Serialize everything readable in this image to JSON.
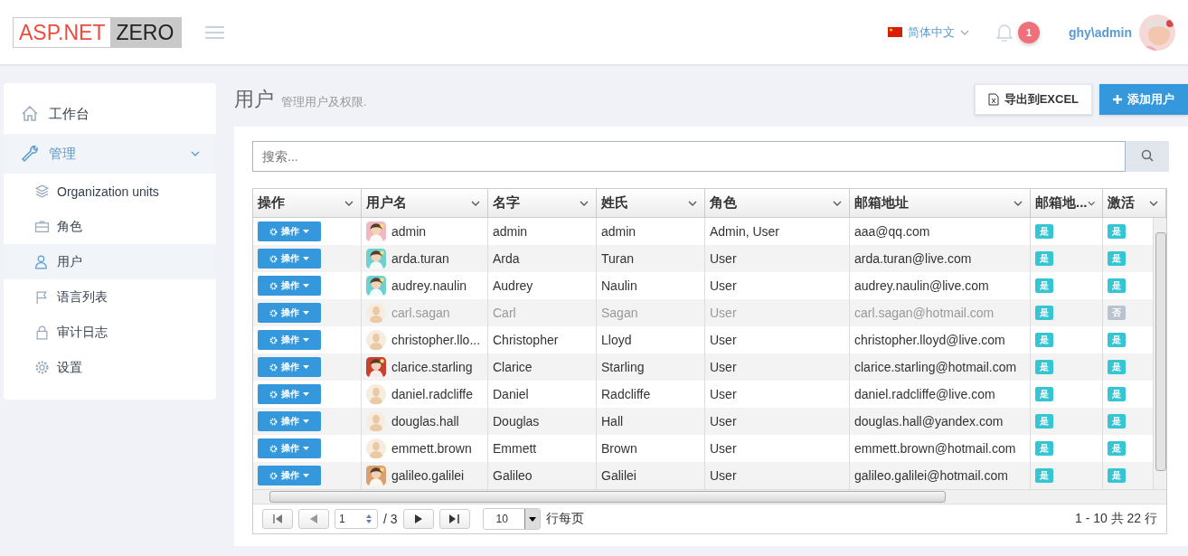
{
  "header": {
    "logo": {
      "left": "ASP.NET",
      "right": "ZERO"
    },
    "language": "简体中文",
    "notifications": "1",
    "user": "ghy\\admin"
  },
  "sidebar": {
    "items": [
      {
        "label": "工作台",
        "selected": false
      },
      {
        "label": "管理",
        "selected": false,
        "expanded": true,
        "children": [
          {
            "label": "Organization units",
            "selected": false
          },
          {
            "label": "角色",
            "selected": false
          },
          {
            "label": "用户",
            "selected": true
          },
          {
            "label": "语言列表",
            "selected": false
          },
          {
            "label": "审计日志",
            "selected": false
          },
          {
            "label": "设置",
            "selected": false
          }
        ]
      }
    ]
  },
  "page": {
    "title": "用户",
    "subtitle": "管理用户及权限.",
    "buttons": [
      {
        "label": "导出到EXCEL",
        "kind": "export"
      },
      {
        "label": "添加用户",
        "kind": "add"
      }
    ]
  },
  "search": {
    "placeholder": "搜索..."
  },
  "table": {
    "columns": [
      "操作",
      "用户名",
      "名字",
      "姓氏",
      "角色",
      "邮箱地址",
      "邮箱地...",
      "激活"
    ],
    "rows": [
      {
        "action": "操作",
        "username": "admin",
        "name": "admin",
        "surname": "admin",
        "roles": "Admin, User",
        "email": "aaa@qq.com",
        "email_confirmed": "是",
        "active_label": "是",
        "active": true
      },
      {
        "action": "操作",
        "username": "arda.turan",
        "name": "Arda",
        "surname": "Turan",
        "roles": "User",
        "email": "arda.turan@live.com",
        "email_confirmed": "是",
        "active_label": "是",
        "active": true
      },
      {
        "action": "操作",
        "username": "audrey.naulin",
        "name": "Audrey",
        "surname": "Naulin",
        "roles": "User",
        "email": "audrey.naulin@live.com",
        "email_confirmed": "是",
        "active_label": "是",
        "active": true
      },
      {
        "action": "操作",
        "avatar": {
          "kind": "default"
        },
        "username": "carl.sagan",
        "name": "Carl",
        "surname": "Sagan",
        "roles": "User",
        "email": "carl.sagan@hotmail.com",
        "email_confirmed": "是",
        "active_label": "否",
        "active": false
      },
      {
        "action": "操作",
        "avatar": {
          "kind": "default"
        },
        "username": "christopher.llo...",
        "name": "Christopher",
        "surname": "Lloyd",
        "roles": "User",
        "email": "christopher.lloyd@live.com",
        "email_confirmed": "是",
        "active_label": "是",
        "active": true
      },
      {
        "action": "操作",
        "username": "clarice.starling",
        "name": "Clarice",
        "surname": "Starling",
        "roles": "User",
        "email": "clarice.starling@hotmail.com",
        "email_confirmed": "是",
        "active_label": "是",
        "active": true
      },
      {
        "action": "操作",
        "avatar": {
          "kind": "default"
        },
        "username": "daniel.radcliffe",
        "name": "Daniel",
        "surname": "Radcliffe",
        "roles": "User",
        "email": "daniel.radcliffe@live.com",
        "email_confirmed": "是",
        "active_label": "是",
        "active": true
      },
      {
        "action": "操作",
        "avatar": {
          "kind": "default"
        },
        "username": "douglas.hall",
        "name": "Douglas",
        "surname": "Hall",
        "roles": "User",
        "email": "douglas.hall@yandex.com",
        "email_confirmed": "是",
        "active_label": "是",
        "active": true
      },
      {
        "action": "操作",
        "avatar": {
          "kind": "default"
        },
        "username": "emmett.brown",
        "name": "Emmett",
        "surname": "Brown",
        "roles": "User",
        "email": "emmett.brown@hotmail.com",
        "email_confirmed": "是",
        "active_label": "是",
        "active": true
      },
      {
        "action": "操作",
        "username": "galileo.galilei",
        "name": "Galileo",
        "surname": "Galilei",
        "roles": "User",
        "email": "galileo.galilei@hotmail.com",
        "email_confirmed": "是",
        "active_label": "是",
        "active": true
      }
    ]
  },
  "pager": {
    "page": "1",
    "of_pages": "/ 3",
    "page_size": "10",
    "per_page_label": "行每页",
    "summary": "1 - 10 共 22 行"
  }
}
